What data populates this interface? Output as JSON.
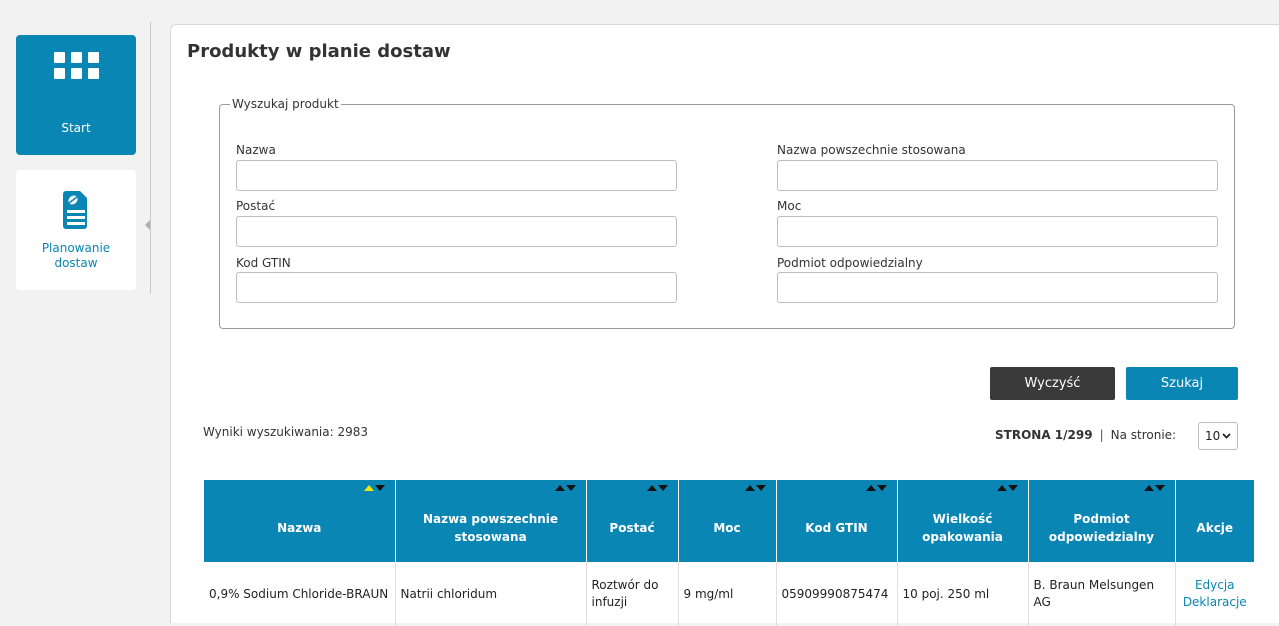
{
  "sidebar": {
    "start_label": "Start",
    "planning_label_1": "Planowanie",
    "planning_label_2": "dostaw"
  },
  "page": {
    "title": "Produkty w planie dostaw"
  },
  "search": {
    "legend": "Wyszukaj produkt",
    "name_label": "Nazwa",
    "common_name_label": "Nazwa powszechnie stosowana",
    "form_label": "Postać",
    "strength_label": "Moc",
    "gtin_label": "Kod GTIN",
    "entity_label": "Podmiot odpowiedzialny",
    "clear_button": "Wyczyść",
    "search_button": "Szukaj"
  },
  "results": {
    "count_text": "Wyniki wyszukiwania: 2983",
    "page_text": "STRONA 1/299",
    "separator": "|",
    "per_page_label": "Na stronie:",
    "per_page_value": "10",
    "columns": [
      "Nazwa",
      "Nazwa powszechnie stosowana",
      "Postać",
      "Moc",
      "Kod GTIN",
      "Wielkość opakowania",
      "Podmiot odpowiedzialny",
      "Akcje"
    ],
    "rows": [
      {
        "name": "0,9% Sodium Chloride-BRAUN",
        "common_name": "Natrii chloridum",
        "form": "Roztwór do infuzji",
        "strength": "9 mg/ml",
        "gtin": "05909990875474",
        "package": "10 poj. 250 ml",
        "entity": "B. Braun Melsungen AG",
        "action_edit": "Edycja",
        "action_declarations": "Deklaracje"
      }
    ]
  },
  "colors": {
    "accent": "#0a86b4",
    "dark_button": "#3a3a3a",
    "active_sort": "#f2e600"
  }
}
